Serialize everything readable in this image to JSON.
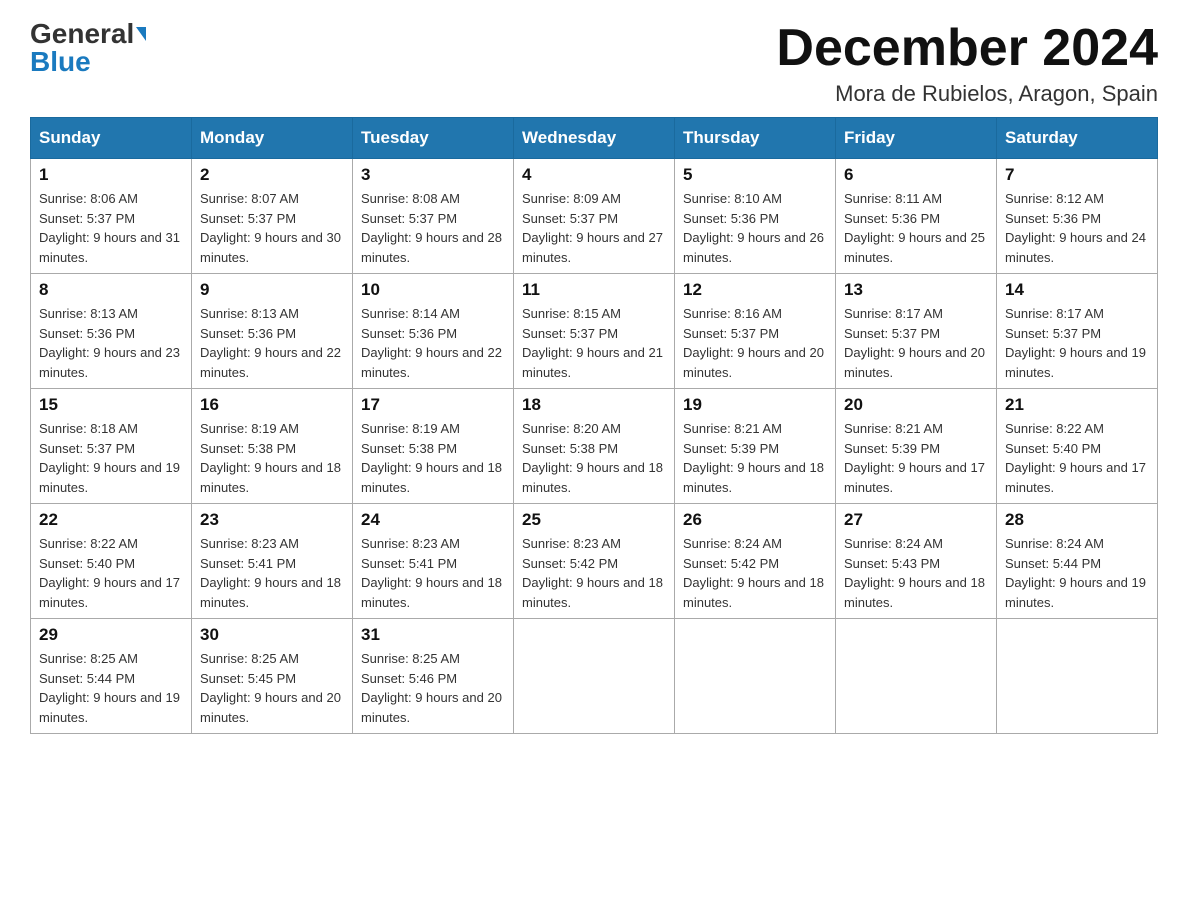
{
  "header": {
    "logo_general": "General",
    "logo_blue": "Blue",
    "month_title": "December 2024",
    "location": "Mora de Rubielos, Aragon, Spain"
  },
  "weekdays": [
    "Sunday",
    "Monday",
    "Tuesday",
    "Wednesday",
    "Thursday",
    "Friday",
    "Saturday"
  ],
  "weeks": [
    [
      {
        "day": "1",
        "sunrise": "8:06 AM",
        "sunset": "5:37 PM",
        "daylight": "9 hours and 31 minutes."
      },
      {
        "day": "2",
        "sunrise": "8:07 AM",
        "sunset": "5:37 PM",
        "daylight": "9 hours and 30 minutes."
      },
      {
        "day": "3",
        "sunrise": "8:08 AM",
        "sunset": "5:37 PM",
        "daylight": "9 hours and 28 minutes."
      },
      {
        "day": "4",
        "sunrise": "8:09 AM",
        "sunset": "5:37 PM",
        "daylight": "9 hours and 27 minutes."
      },
      {
        "day": "5",
        "sunrise": "8:10 AM",
        "sunset": "5:36 PM",
        "daylight": "9 hours and 26 minutes."
      },
      {
        "day": "6",
        "sunrise": "8:11 AM",
        "sunset": "5:36 PM",
        "daylight": "9 hours and 25 minutes."
      },
      {
        "day": "7",
        "sunrise": "8:12 AM",
        "sunset": "5:36 PM",
        "daylight": "9 hours and 24 minutes."
      }
    ],
    [
      {
        "day": "8",
        "sunrise": "8:13 AM",
        "sunset": "5:36 PM",
        "daylight": "9 hours and 23 minutes."
      },
      {
        "day": "9",
        "sunrise": "8:13 AM",
        "sunset": "5:36 PM",
        "daylight": "9 hours and 22 minutes."
      },
      {
        "day": "10",
        "sunrise": "8:14 AM",
        "sunset": "5:36 PM",
        "daylight": "9 hours and 22 minutes."
      },
      {
        "day": "11",
        "sunrise": "8:15 AM",
        "sunset": "5:37 PM",
        "daylight": "9 hours and 21 minutes."
      },
      {
        "day": "12",
        "sunrise": "8:16 AM",
        "sunset": "5:37 PM",
        "daylight": "9 hours and 20 minutes."
      },
      {
        "day": "13",
        "sunrise": "8:17 AM",
        "sunset": "5:37 PM",
        "daylight": "9 hours and 20 minutes."
      },
      {
        "day": "14",
        "sunrise": "8:17 AM",
        "sunset": "5:37 PM",
        "daylight": "9 hours and 19 minutes."
      }
    ],
    [
      {
        "day": "15",
        "sunrise": "8:18 AM",
        "sunset": "5:37 PM",
        "daylight": "9 hours and 19 minutes."
      },
      {
        "day": "16",
        "sunrise": "8:19 AM",
        "sunset": "5:38 PM",
        "daylight": "9 hours and 18 minutes."
      },
      {
        "day": "17",
        "sunrise": "8:19 AM",
        "sunset": "5:38 PM",
        "daylight": "9 hours and 18 minutes."
      },
      {
        "day": "18",
        "sunrise": "8:20 AM",
        "sunset": "5:38 PM",
        "daylight": "9 hours and 18 minutes."
      },
      {
        "day": "19",
        "sunrise": "8:21 AM",
        "sunset": "5:39 PM",
        "daylight": "9 hours and 18 minutes."
      },
      {
        "day": "20",
        "sunrise": "8:21 AM",
        "sunset": "5:39 PM",
        "daylight": "9 hours and 17 minutes."
      },
      {
        "day": "21",
        "sunrise": "8:22 AM",
        "sunset": "5:40 PM",
        "daylight": "9 hours and 17 minutes."
      }
    ],
    [
      {
        "day": "22",
        "sunrise": "8:22 AM",
        "sunset": "5:40 PM",
        "daylight": "9 hours and 17 minutes."
      },
      {
        "day": "23",
        "sunrise": "8:23 AM",
        "sunset": "5:41 PM",
        "daylight": "9 hours and 18 minutes."
      },
      {
        "day": "24",
        "sunrise": "8:23 AM",
        "sunset": "5:41 PM",
        "daylight": "9 hours and 18 minutes."
      },
      {
        "day": "25",
        "sunrise": "8:23 AM",
        "sunset": "5:42 PM",
        "daylight": "9 hours and 18 minutes."
      },
      {
        "day": "26",
        "sunrise": "8:24 AM",
        "sunset": "5:42 PM",
        "daylight": "9 hours and 18 minutes."
      },
      {
        "day": "27",
        "sunrise": "8:24 AM",
        "sunset": "5:43 PM",
        "daylight": "9 hours and 18 minutes."
      },
      {
        "day": "28",
        "sunrise": "8:24 AM",
        "sunset": "5:44 PM",
        "daylight": "9 hours and 19 minutes."
      }
    ],
    [
      {
        "day": "29",
        "sunrise": "8:25 AM",
        "sunset": "5:44 PM",
        "daylight": "9 hours and 19 minutes."
      },
      {
        "day": "30",
        "sunrise": "8:25 AM",
        "sunset": "5:45 PM",
        "daylight": "9 hours and 20 minutes."
      },
      {
        "day": "31",
        "sunrise": "8:25 AM",
        "sunset": "5:46 PM",
        "daylight": "9 hours and 20 minutes."
      },
      null,
      null,
      null,
      null
    ]
  ]
}
